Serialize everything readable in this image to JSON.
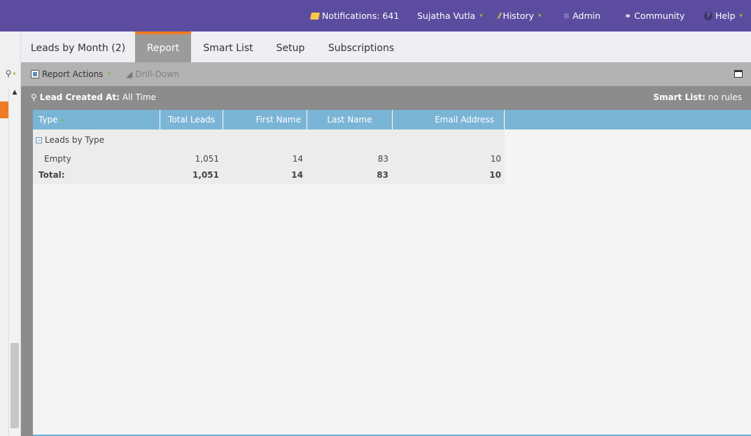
{
  "topbar": {
    "notifications": "Notifications: 641",
    "user": "Sujatha Vutla",
    "history": "History",
    "admin": "Admin",
    "community": "Community",
    "help": "Help",
    "colors": {
      "bg": "#5c4c9f",
      "caret": "#7fc241"
    }
  },
  "tabs": [
    {
      "label": "Leads by Month (2)",
      "active": false
    },
    {
      "label": "Report",
      "active": true
    },
    {
      "label": "Smart List",
      "active": false
    },
    {
      "label": "Setup",
      "active": false
    },
    {
      "label": "Subscriptions",
      "active": false
    }
  ],
  "toolbar": {
    "report_actions": "Report Actions",
    "drill_down": "Drill-Down"
  },
  "filter": {
    "lead_created_label": "Lead Created At:",
    "lead_created_value": "All Time",
    "smart_list_label": "Smart List:",
    "smart_list_value": "no rules"
  },
  "grid": {
    "columns": [
      "Type",
      "Total Leads",
      "First Name",
      "Last Name",
      "Email Address"
    ],
    "group_label": "Leads by Type",
    "rows": [
      {
        "type": "Empty",
        "total_leads": "1,051",
        "first_name": "14",
        "last_name": "83",
        "email": "10"
      }
    ],
    "total": {
      "label": "Total:",
      "total_leads": "1,051",
      "first_name": "14",
      "last_name": "83",
      "email": "10"
    }
  },
  "colors": {
    "accent": "#ef7b22",
    "header_blue": "#7ab5d6"
  }
}
